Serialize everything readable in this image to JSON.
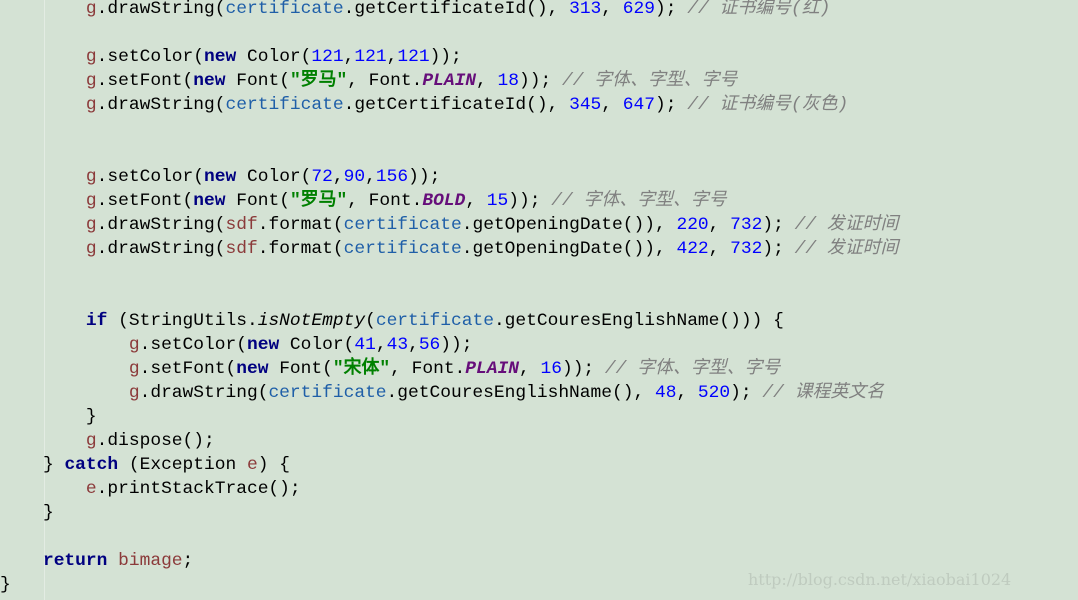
{
  "lines": [
    [
      [
        "    "
      ],
      [
        "g",
        "var"
      ],
      [
        ".drawString("
      ],
      [
        "certificate",
        "obj"
      ],
      [
        ".getCertificateId(), "
      ],
      [
        "313",
        "num"
      ],
      [
        ", "
      ],
      [
        "629",
        "num"
      ],
      [
        "); "
      ],
      [
        "// 证书编号(红)",
        "cmt"
      ]
    ],
    [],
    [
      [
        "    "
      ],
      [
        "g",
        "var"
      ],
      [
        ".setColor("
      ],
      [
        "new",
        "kw"
      ],
      [
        " Color("
      ],
      [
        "121",
        "num"
      ],
      [
        ","
      ],
      [
        "121",
        "num"
      ],
      [
        ","
      ],
      [
        "121",
        "num"
      ],
      [
        "));"
      ]
    ],
    [
      [
        "    "
      ],
      [
        "g",
        "var"
      ],
      [
        ".setFont("
      ],
      [
        "new",
        "kw"
      ],
      [
        " Font("
      ],
      [
        "\"罗马\"",
        "str"
      ],
      [
        ", Font."
      ],
      [
        "PLAIN",
        "fld"
      ],
      [
        ", "
      ],
      [
        "18",
        "num"
      ],
      [
        ")); "
      ],
      [
        "// 字体、字型、字号",
        "cmt"
      ]
    ],
    [
      [
        "    "
      ],
      [
        "g",
        "var"
      ],
      [
        ".drawString("
      ],
      [
        "certificate",
        "obj"
      ],
      [
        ".getCertificateId(), "
      ],
      [
        "345",
        "num"
      ],
      [
        ", "
      ],
      [
        "647",
        "num"
      ],
      [
        "); "
      ],
      [
        "// 证书编号(灰色)",
        "cmt"
      ]
    ],
    [],
    [],
    [
      [
        "    "
      ],
      [
        "g",
        "var"
      ],
      [
        ".setColor("
      ],
      [
        "new",
        "kw"
      ],
      [
        " Color("
      ],
      [
        "72",
        "num"
      ],
      [
        ","
      ],
      [
        "90",
        "num"
      ],
      [
        ","
      ],
      [
        "156",
        "num"
      ],
      [
        "));"
      ]
    ],
    [
      [
        "    "
      ],
      [
        "g",
        "var"
      ],
      [
        ".setFont("
      ],
      [
        "new",
        "kw"
      ],
      [
        " Font("
      ],
      [
        "\"罗马\"",
        "str"
      ],
      [
        ", Font."
      ],
      [
        "BOLD",
        "fld"
      ],
      [
        ", "
      ],
      [
        "15",
        "num"
      ],
      [
        ")); "
      ],
      [
        "// 字体、字型、字号",
        "cmt"
      ]
    ],
    [
      [
        "    "
      ],
      [
        "g",
        "var"
      ],
      [
        ".drawString("
      ],
      [
        "sdf",
        "var"
      ],
      [
        ".format("
      ],
      [
        "certificate",
        "obj"
      ],
      [
        ".getOpeningDate()), "
      ],
      [
        "220",
        "num"
      ],
      [
        ", "
      ],
      [
        "732",
        "num"
      ],
      [
        "); "
      ],
      [
        "// 发证时间",
        "cmt"
      ]
    ],
    [
      [
        "    "
      ],
      [
        "g",
        "var"
      ],
      [
        ".drawString("
      ],
      [
        "sdf",
        "var"
      ],
      [
        ".format("
      ],
      [
        "certificate",
        "obj"
      ],
      [
        ".getOpeningDate()), "
      ],
      [
        "422",
        "num"
      ],
      [
        ", "
      ],
      [
        "732",
        "num"
      ],
      [
        "); "
      ],
      [
        "// 发证时间",
        "cmt"
      ]
    ],
    [],
    [],
    [
      [
        "    "
      ],
      [
        "if",
        "kw"
      ],
      [
        " (StringUtils."
      ],
      [
        "isNotEmpty",
        "sm"
      ],
      [
        "("
      ],
      [
        "certificate",
        "obj"
      ],
      [
        ".getCouresEnglishName())) {"
      ]
    ],
    [
      [
        "        "
      ],
      [
        "g",
        "var"
      ],
      [
        ".setColor("
      ],
      [
        "new",
        "kw"
      ],
      [
        " Color("
      ],
      [
        "41",
        "num"
      ],
      [
        ","
      ],
      [
        "43",
        "num"
      ],
      [
        ","
      ],
      [
        "56",
        "num"
      ],
      [
        "));"
      ]
    ],
    [
      [
        "        "
      ],
      [
        "g",
        "var"
      ],
      [
        ".setFont("
      ],
      [
        "new",
        "kw"
      ],
      [
        " Font("
      ],
      [
        "\"宋体\"",
        "str"
      ],
      [
        ", Font."
      ],
      [
        "PLAIN",
        "fld"
      ],
      [
        ", "
      ],
      [
        "16",
        "num"
      ],
      [
        ")); "
      ],
      [
        "// 字体、字型、字号",
        "cmt"
      ]
    ],
    [
      [
        "        "
      ],
      [
        "g",
        "var"
      ],
      [
        ".drawString("
      ],
      [
        "certificate",
        "obj"
      ],
      [
        ".getCouresEnglishName(), "
      ],
      [
        "48",
        "num"
      ],
      [
        ", "
      ],
      [
        "520",
        "num"
      ],
      [
        "); "
      ],
      [
        "// 课程英文名",
        "cmt"
      ]
    ],
    [
      [
        "    }"
      ]
    ],
    [
      [
        "    "
      ],
      [
        "g",
        "var"
      ],
      [
        ".dispose();"
      ]
    ],
    [
      [
        "} "
      ],
      [
        "catch",
        "kw"
      ],
      [
        " (Exception "
      ],
      [
        "e",
        "var"
      ],
      [
        ") {"
      ]
    ],
    [
      [
        "    "
      ],
      [
        "e",
        "var"
      ],
      [
        ".printStackTrace();"
      ]
    ],
    [
      [
        "}"
      ]
    ],
    [],
    [
      [
        "    "
      ],
      [
        "return",
        "kw"
      ],
      [
        " "
      ],
      [
        "bimage",
        "var"
      ],
      [
        ";"
      ]
    ],
    [
      [
        "}"
      ]
    ]
  ],
  "indent_prefix": [
    "    ",
    "    ",
    "    ",
    "    ",
    "    ",
    "    ",
    "    ",
    "    ",
    "    ",
    "    ",
    "    ",
    "    ",
    "    ",
    "    ",
    "    ",
    "    ",
    "    ",
    "    ",
    "    ",
    "    ",
    "    ",
    "    ",
    "    ",
    "",
    ""
  ],
  "watermark": "http://blog.csdn.net/xiaobai1024"
}
